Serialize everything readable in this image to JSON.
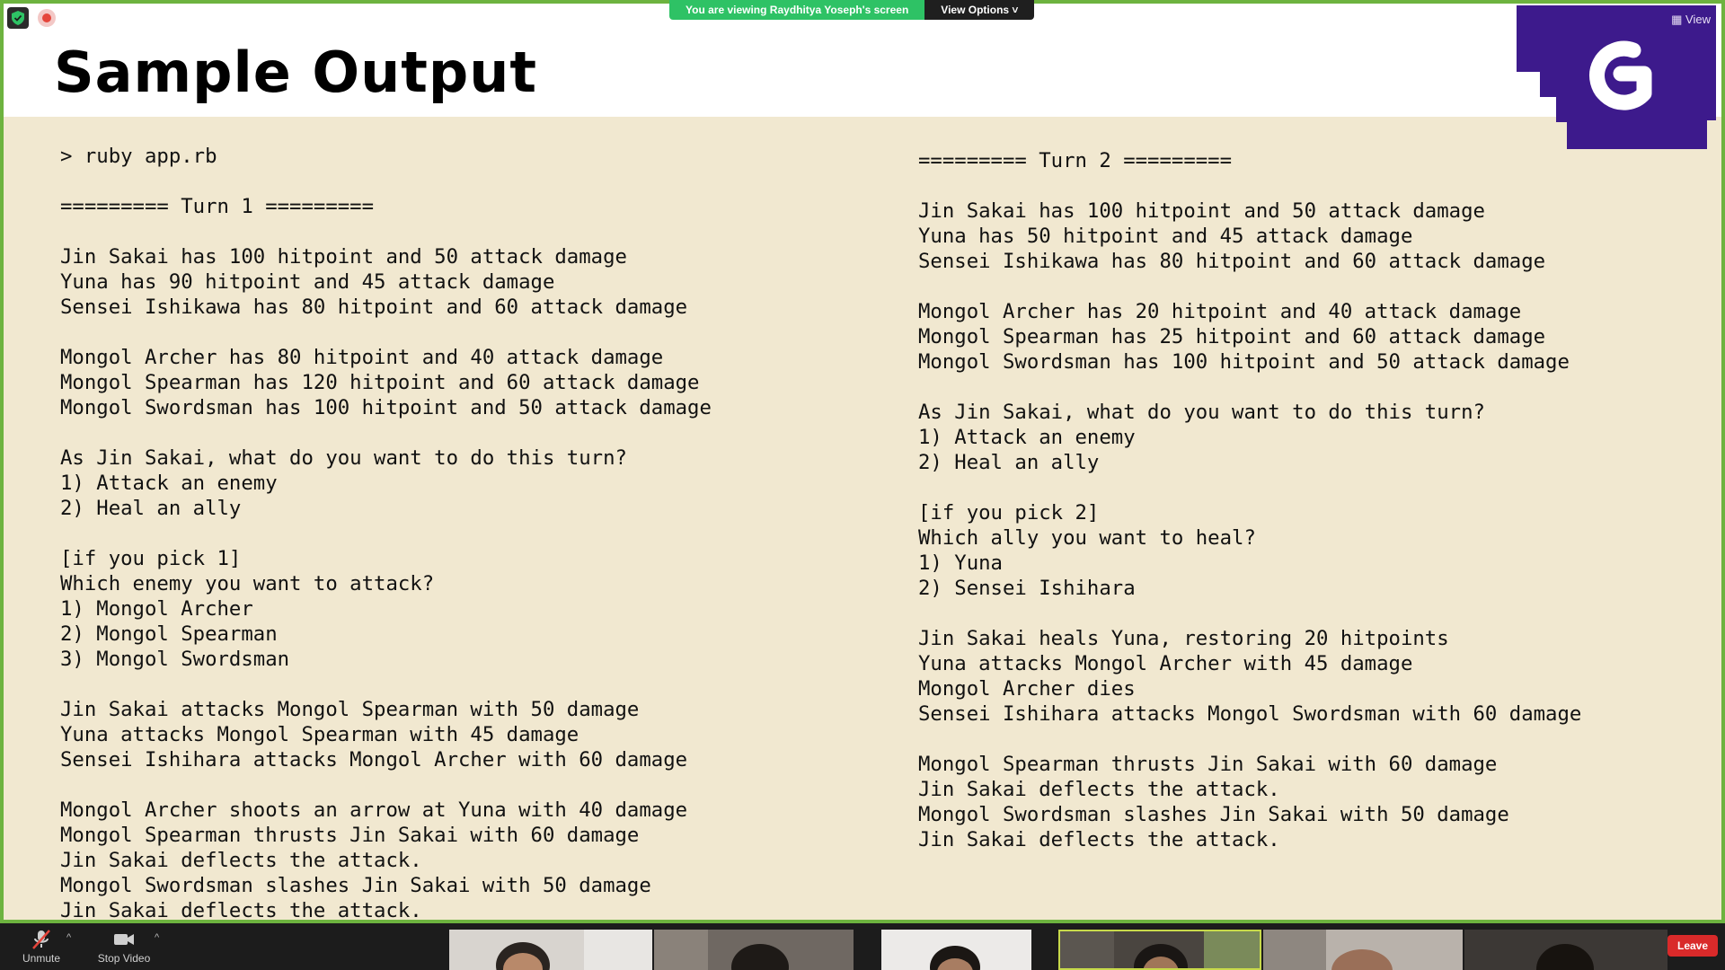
{
  "meeting": {
    "viewing_text": "You are viewing Raydhitya Yoseph's screen",
    "view_options_label": "View Options",
    "top_right_view_label": "View",
    "leave_label": "Leave"
  },
  "toolbar": {
    "unmute_label": "Unmute",
    "stop_video_label": "Stop Video"
  },
  "slide": {
    "title": "Sample Output",
    "left_lines": [
      "> ruby app.rb",
      "",
      "========= Turn 1 =========",
      "",
      "Jin Sakai has 100 hitpoint and 50 attack damage",
      "Yuna has 90 hitpoint and 45 attack damage",
      "Sensei Ishikawa has 80 hitpoint and 60 attack damage",
      "",
      "Mongol Archer has 80 hitpoint and 40 attack damage",
      "Mongol Spearman has 120 hitpoint and 60 attack damage",
      "Mongol Swordsman has 100 hitpoint and 50 attack damage",
      "",
      "As Jin Sakai, what do you want to do this turn?",
      "1) Attack an enemy",
      "2) Heal an ally",
      "",
      "[if you pick 1]",
      "Which enemy you want to attack?",
      "1) Mongol Archer",
      "2) Mongol Spearman",
      "3) Mongol Swordsman",
      "",
      "Jin Sakai attacks Mongol Spearman with 50 damage",
      "Yuna attacks Mongol Spearman with 45 damage",
      "Sensei Ishihara attacks Mongol Archer with 60 damage",
      "",
      "Mongol Archer shoots an arrow at Yuna with 40 damage",
      "Mongol Spearman thrusts Jin Sakai with 60 damage",
      "Jin Sakai deflects the attack.",
      "Mongol Swordsman slashes Jin Sakai with 50 damage",
      "Jin Sakai deflects the attack."
    ],
    "right_lines": [
      "========= Turn 2 =========",
      "",
      "Jin Sakai has 100 hitpoint and 50 attack damage",
      "Yuna has 50 hitpoint and 45 attack damage",
      "Sensei Ishikawa has 80 hitpoint and 60 attack damage",
      "",
      "Mongol Archer has 20 hitpoint and 40 attack damage",
      "Mongol Spearman has 25 hitpoint and 60 attack damage",
      "Mongol Swordsman has 100 hitpoint and 50 attack damage",
      "",
      "As Jin Sakai, what do you want to do this turn?",
      "1) Attack an enemy",
      "2) Heal an ally",
      "",
      "[if you pick 2]",
      "Which ally you want to heal?",
      "1) Yuna",
      "2) Sensei Ishihara",
      "",
      "Jin Sakai heals Yuna, restoring 20 hitpoints",
      "Yuna attacks Mongol Archer with 45 damage",
      "Mongol Archer dies",
      "Sensei Ishihara attacks Mongol Swordsman with 60 damage",
      "",
      "Mongol Spearman thrusts Jin Sakai with 60 damage",
      "Jin Sakai deflects the attack.",
      "Mongol Swordsman slashes Jin Sakai with 50 damage",
      "Jin Sakai deflects the attack."
    ]
  },
  "colors": {
    "slide_background": "#f1e8d0",
    "share_border": "#6db33f",
    "brand_purple": "#3d1a8c",
    "leave_red": "#d92a2a"
  },
  "icons": [
    "shield-icon",
    "record-icon",
    "microphone-muted-icon",
    "video-camera-icon",
    "chevron-up-icon",
    "grid-view-icon"
  ]
}
